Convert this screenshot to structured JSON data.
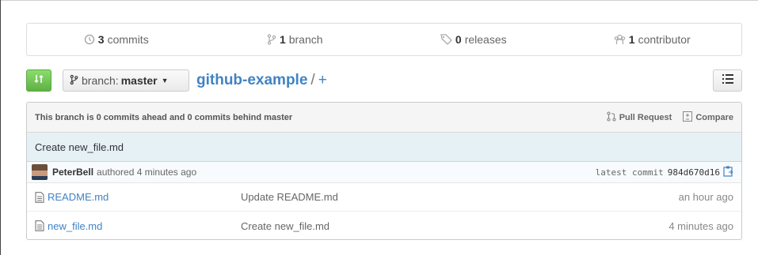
{
  "summary": {
    "commits": {
      "count": "3",
      "label": "commits"
    },
    "branches": {
      "count": "1",
      "label": "branch"
    },
    "releases": {
      "count": "0",
      "label": "releases"
    },
    "contributors": {
      "count": "1",
      "label": "contributor"
    }
  },
  "toolbar": {
    "branch_label": "branch:",
    "branch_value": "master",
    "repo_name": "github-example",
    "path_separator": "/",
    "add_file": "+"
  },
  "tease": {
    "message": "This branch is 0 commits ahead and 0 commits behind master",
    "pull_request": "Pull Request",
    "compare": "Compare"
  },
  "latest_commit": {
    "title": "Create new_file.md",
    "author": "PeterBell",
    "authored": "authored 4 minutes ago",
    "label": "latest commit",
    "sha": "984d670d16"
  },
  "files": [
    {
      "name": "README.md",
      "message": "Update README.md",
      "age": "an hour ago"
    },
    {
      "name": "new_file.md",
      "message": "Create new_file.md",
      "age": "4 minutes ago"
    }
  ],
  "colors": {
    "link": "#4183c4",
    "green_button": "#60b044",
    "commit_bg": "#e6f1f6"
  }
}
